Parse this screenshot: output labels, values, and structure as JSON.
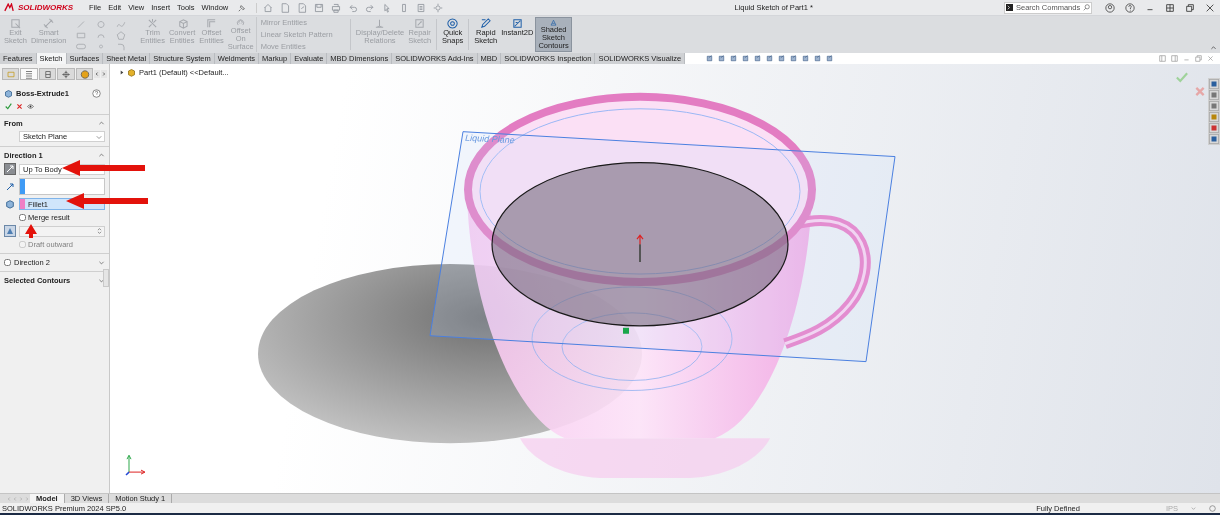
{
  "app": {
    "logo": "SOLIDWORKS",
    "menu": [
      "File",
      "Edit",
      "View",
      "Insert",
      "Tools",
      "Window"
    ],
    "title": "Liquid Sketch of Part1 *",
    "search": {
      "placeholder": "Search Commands"
    }
  },
  "ribbon": [
    {
      "kind": "button",
      "label": "Exit Sketch",
      "disabled": true,
      "selected": false
    },
    {
      "kind": "button",
      "label": "Smart Dimension",
      "disabled": true,
      "selected": false
    },
    {
      "kind": "tools"
    },
    {
      "kind": "button",
      "label": "Trim Entities",
      "disabled": true,
      "selected": false
    },
    {
      "kind": "button",
      "label": "Convert Entities",
      "disabled": true,
      "selected": false
    },
    {
      "kind": "button",
      "label": "Offset Entities",
      "disabled": true,
      "selected": false
    },
    {
      "kind": "button",
      "label": "Offset On Surface",
      "disabled": true,
      "selected": false
    },
    {
      "kind": "stack",
      "entries": [
        {
          "label": "Mirror Entities",
          "disabled": true
        },
        {
          "label": "Linear Sketch Pattern",
          "disabled": true
        },
        {
          "label": "Move Entities",
          "disabled": true
        }
      ]
    },
    {
      "kind": "separator"
    },
    {
      "kind": "button",
      "label": "Display/Delete Relations",
      "disabled": true,
      "selected": false
    },
    {
      "kind": "button",
      "label": "Repair Sketch",
      "disabled": true,
      "selected": false
    },
    {
      "kind": "separator"
    },
    {
      "kind": "button",
      "label": "Quick Snaps",
      "disabled": false,
      "selected": false
    },
    {
      "kind": "separator"
    },
    {
      "kind": "button",
      "label": "Rapid Sketch",
      "disabled": false,
      "selected": false
    },
    {
      "kind": "button",
      "label": "Instant2D",
      "disabled": false,
      "selected": false
    },
    {
      "kind": "button",
      "label": "Shaded Sketch Contours",
      "disabled": false,
      "selected": true
    }
  ],
  "tabs": [
    {
      "label": "Features",
      "selected": false
    },
    {
      "label": "Sketch",
      "selected": true
    },
    {
      "label": "Surfaces",
      "selected": false
    },
    {
      "label": "Sheet Metal",
      "selected": false
    },
    {
      "label": "Structure System",
      "selected": false
    },
    {
      "label": "Weldments",
      "selected": false
    },
    {
      "label": "Markup",
      "selected": false
    },
    {
      "label": "Evaluate",
      "selected": false
    },
    {
      "label": "MBD Dimensions",
      "selected": false
    },
    {
      "label": "SOLIDWORKS Add-Ins",
      "selected": false
    },
    {
      "label": "MBD",
      "selected": false
    },
    {
      "label": "SOLIDWORKS Inspection",
      "selected": false
    },
    {
      "label": "SOLIDWORKS Visualize",
      "selected": false
    }
  ],
  "property_manager": {
    "panel_tabs": [
      {
        "selected": false
      },
      {
        "selected": true
      },
      {
        "selected": false
      },
      {
        "selected": false
      },
      {
        "selected": false
      }
    ],
    "title": "Boss-Extrude1",
    "from": {
      "title": "From",
      "expanded": true,
      "start": "Sketch Plane"
    },
    "direction1": {
      "title": "Direction 1",
      "expanded": true,
      "end_condition": "Up To Body",
      "body": "Fillet1",
      "merge_result": {
        "label": "Merge result",
        "checked": false
      },
      "draft_outward": {
        "label": "Draft outward",
        "checked": false,
        "disabled": true
      }
    },
    "direction2": {
      "label": "Direction 2",
      "checked": false,
      "expanded": false
    },
    "selected_contours": {
      "title": "Selected Contours",
      "expanded": false
    }
  },
  "viewport": {
    "breadcrumb": "Part1 (Default) <<Default...",
    "plane_label": "Liquid Plane"
  },
  "bottom_tabs": [
    {
      "label": "Model",
      "selected": true
    },
    {
      "label": "3D Views",
      "selected": false
    },
    {
      "label": "Motion Study 1",
      "selected": false
    }
  ],
  "status_bar": {
    "product": "SOLIDWORKS Premium 2024 SP5.0",
    "sketch_status": "Fully Defined",
    "units": "IPS"
  }
}
